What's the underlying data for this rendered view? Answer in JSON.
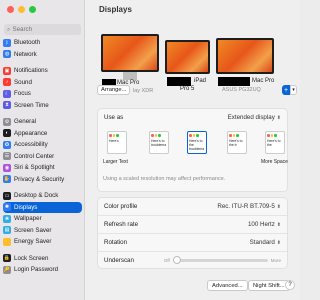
{
  "window": {
    "title": "Displays"
  },
  "colors": {
    "accent": "#0a64d8",
    "close": "#ff5f57",
    "minimize": "#febc2e",
    "zoom": "#28c840"
  },
  "search": {
    "placeholder": "Search",
    "icon": "search-icon"
  },
  "sidebar": {
    "items": [
      {
        "label": "Bluetooth",
        "color": "#2f7cf6",
        "glyph": "ᛒ"
      },
      {
        "label": "Network",
        "color": "#2f7cf6",
        "glyph": "◍"
      },
      {
        "label": "Notifications",
        "color": "#ff3b30",
        "glyph": "▣"
      },
      {
        "label": "Sound",
        "color": "#ff3b30",
        "glyph": "♪"
      },
      {
        "label": "Focus",
        "color": "#5e5ce6",
        "glyph": "☾"
      },
      {
        "label": "Screen Time",
        "color": "#5e5ce6",
        "glyph": "⧗"
      },
      {
        "label": "General",
        "color": "#8e8e93",
        "glyph": "⚙"
      },
      {
        "label": "Appearance",
        "color": "#1d1d1f",
        "glyph": "◐"
      },
      {
        "label": "Accessibility",
        "color": "#2f7cf6",
        "glyph": "✪"
      },
      {
        "label": "Control Center",
        "color": "#8e8e93",
        "glyph": "☰"
      },
      {
        "label": "Siri & Spotlight",
        "color": "#af52de",
        "glyph": "◉"
      },
      {
        "label": "Privacy & Security",
        "color": "#2f7cf6",
        "glyph": "✋"
      },
      {
        "label": "Desktop & Dock",
        "color": "#1d1d1f",
        "glyph": "▭"
      },
      {
        "label": "Displays",
        "color": "#2f7cf6",
        "glyph": "✺"
      },
      {
        "label": "Wallpaper",
        "color": "#32ade6",
        "glyph": "❀"
      },
      {
        "label": "Screen Saver",
        "color": "#32ade6",
        "glyph": "▤"
      },
      {
        "label": "Energy Saver",
        "color": "#febc2e",
        "glyph": "⚡"
      },
      {
        "label": "Lock Screen",
        "color": "#1d1d1f",
        "glyph": "🔒"
      },
      {
        "label": "Login Password",
        "color": "#8e8e93",
        "glyph": "🔑"
      }
    ]
  },
  "monitors": [
    {
      "name": "Mac Pro",
      "sub": "lay XDR"
    },
    {
      "name": "iPad",
      "sub": "Pro 5"
    },
    {
      "name": "Mac Pro",
      "sub": "ASUS PG32UQ"
    }
  ],
  "buttons": {
    "arrange": "Arrange...",
    "add": "+",
    "add_chevron": "▾",
    "advanced": "Advanced...",
    "night_shift": "Night Shift...",
    "help": "?"
  },
  "use_as": {
    "label": "Use as",
    "value": "Extended display"
  },
  "resolution": {
    "thumbs": [
      {
        "text": "Here's"
      },
      {
        "text": "Here's to troublema"
      },
      {
        "text": "Here's to the troublema"
      },
      {
        "text": "Here's to the tr"
      },
      {
        "text": "Here's to the"
      }
    ],
    "larger_text": "Larger Text",
    "more_space": "More Space",
    "hint": "Using a scaled resolution may affect performance."
  },
  "settings": {
    "color_profile": {
      "label": "Color profile",
      "value": "Rec. ITU-R BT.709-5"
    },
    "refresh_rate": {
      "label": "Refresh rate",
      "value": "100 Hertz"
    },
    "rotation": {
      "label": "Rotation",
      "value": "Standard"
    },
    "underscan": {
      "label": "Underscan",
      "off": "Off",
      "more": "More",
      "level": 0
    }
  }
}
